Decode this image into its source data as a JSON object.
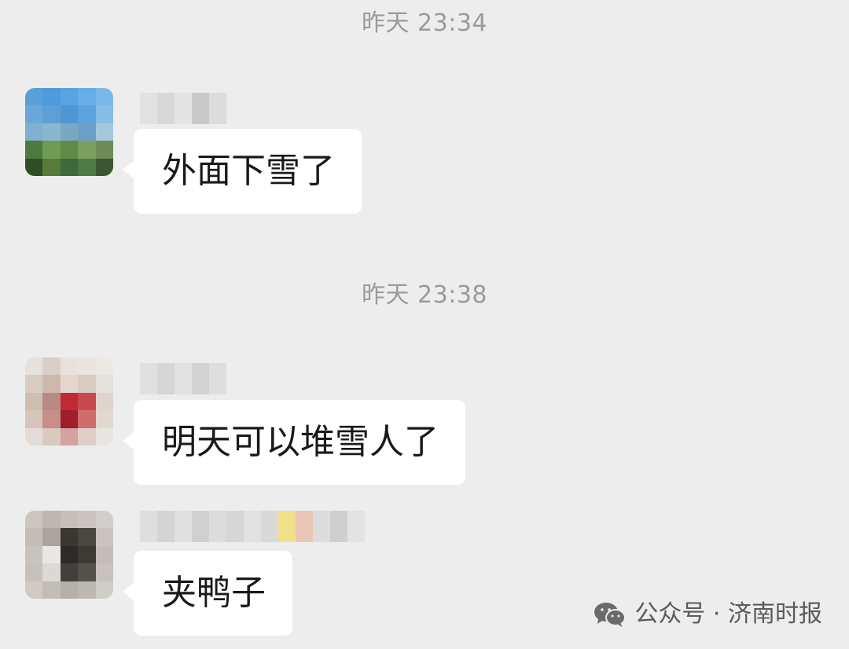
{
  "conversation": {
    "timestamps": [
      "昨天 23:34",
      "昨天 23:38"
    ],
    "messages": [
      {
        "text": "外面下雪了",
        "sender_name_redacted": true,
        "avatar_redacted": true
      },
      {
        "text": "明天可以堆雪人了",
        "sender_name_redacted": true,
        "avatar_redacted": true
      },
      {
        "text": "夹鸭子",
        "sender_name_redacted": true,
        "avatar_redacted": true
      }
    ]
  },
  "watermark": {
    "label": "公众号 · 济南时报",
    "icon": "wechat-icon"
  },
  "colors": {
    "background": "#ededed",
    "bubble": "#ffffff",
    "timestamp_text": "#9a9a9a",
    "message_text": "#1a1a1a"
  }
}
